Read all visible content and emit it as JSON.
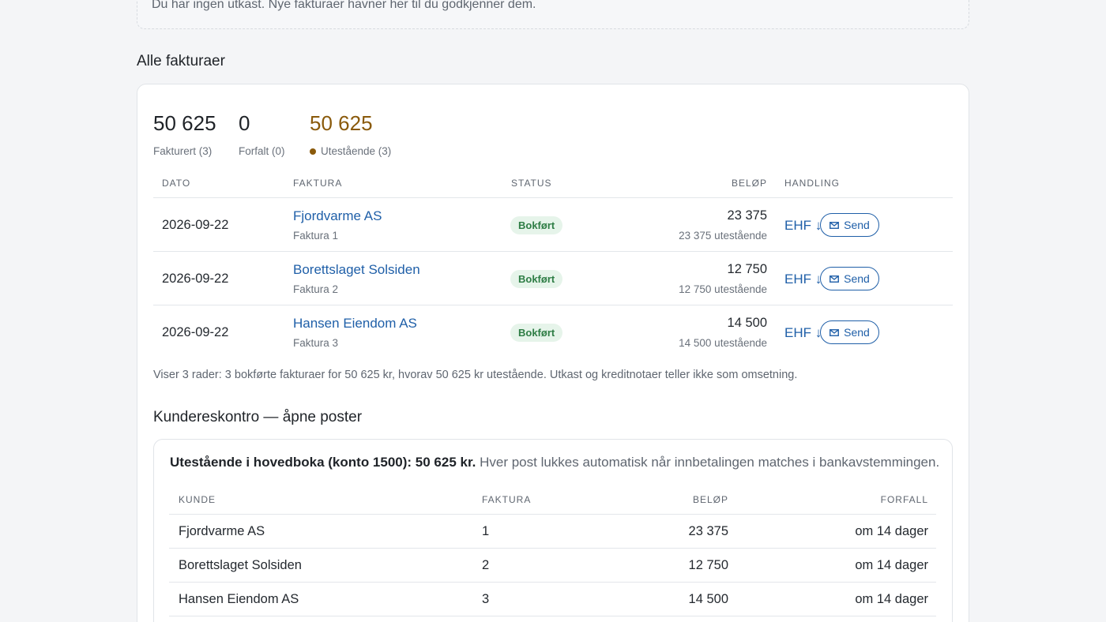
{
  "drafts": {
    "empty_message": "Du har ingen utkast. Nye fakturaer havner her til du godkjenner dem."
  },
  "all_invoices": {
    "title": "Alle fakturaer",
    "kpis": {
      "invoiced": {
        "value": "50 625",
        "label": "Fakturert (3)"
      },
      "overdue": {
        "value": "0",
        "label": "Forfalt (0)"
      },
      "outstanding": {
        "value": "50 625",
        "label": "Utestående (3)",
        "color": "#8a5a0b"
      }
    },
    "columns": {
      "date": "DATO",
      "invoice": "FAKTURA",
      "status": "STATUS",
      "amount": "BELØP",
      "action": "HANDLING"
    },
    "rows": [
      {
        "date": "2026-09-22",
        "customer": "Fjordvarme AS",
        "invoice": "Faktura 1",
        "status": "Bokført",
        "amount": "23 375",
        "outstanding": "23 375 utestående",
        "ehf": "EHF ↓",
        "send": "Send"
      },
      {
        "date": "2026-09-22",
        "customer": "Borettslaget Solsiden",
        "invoice": "Faktura 2",
        "status": "Bokført",
        "amount": "12 750",
        "outstanding": "12 750 utestående",
        "ehf": "EHF ↓",
        "send": "Send"
      },
      {
        "date": "2026-09-22",
        "customer": "Hansen Eiendom AS",
        "invoice": "Faktura 3",
        "status": "Bokført",
        "amount": "14 500",
        "outstanding": "14 500 utestående",
        "ehf": "EHF ↓",
        "send": "Send"
      }
    ],
    "footnote": "Viser 3 rader: 3 bokførte fakturaer for 50 625 kr, hvorav 50 625 kr utestående. Utkast og kreditnotaer teller ikke som omsetning."
  },
  "ledger": {
    "title": "Kundereskontro — åpne poster",
    "summary_strong": "Utestående i hovedboka (konto 1500): 50 625 kr.",
    "summary_rest": " Hver post lukkes automatisk når innbetalingen matches i bankavstemmingen.",
    "columns": {
      "customer": "KUNDE",
      "invoice": "FAKTURA",
      "amount": "BELØP",
      "due": "FORFALL"
    },
    "rows": [
      {
        "customer": "Fjordvarme AS",
        "invoice": "1",
        "amount": "23 375",
        "due": "om 14 dager"
      },
      {
        "customer": "Borettslaget Solsiden",
        "invoice": "2",
        "amount": "12 750",
        "due": "om 14 dager"
      },
      {
        "customer": "Hansen Eiendom AS",
        "invoice": "3",
        "amount": "14 500",
        "due": "om 14 dager"
      }
    ]
  },
  "colors": {
    "link": "#1f5fa8",
    "status_bg": "#e6f4ea",
    "status_text": "#2e7d45"
  },
  "icons": {
    "send": "mail-icon",
    "ehf": "download-arrow-icon"
  }
}
